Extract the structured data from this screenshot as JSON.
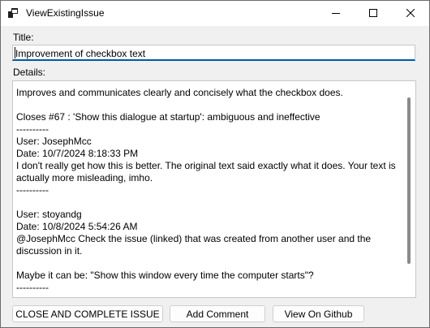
{
  "window": {
    "title": "ViewExistingIssue",
    "icons": {
      "app": "app-window-icon",
      "minimize": "minimize-icon",
      "maximize": "maximize-icon",
      "close": "close-icon"
    }
  },
  "form": {
    "title_label": "Title:",
    "title_value": "Improvement of checkbox text",
    "details_label": "Details:",
    "details_text": "Improves and communicates clearly and concisely what the checkbox does.\n\nCloses #67 : 'Show this dialogue at startup': ambiguous and ineffective\n----------\nUser: JosephMcc\nDate: 10/7/2024 8:18:33 PM\nI don't really get how this is better. The original text said exactly what it does. Your text is actually more misleading, imho.\n----------\n\nUser: stoyandg\nDate: 10/8/2024 5:54:26 AM\n@JosephMcc Check the issue (linked) that was created from another user and the discussion in it.\n\nMaybe it can be: \"Show this window every time the computer starts\"?\n----------"
  },
  "buttons": {
    "close_issue": "CLOSE AND COMPLETE  ISSUE",
    "add_comment": "Add Comment",
    "view_github": "View On Github"
  }
}
